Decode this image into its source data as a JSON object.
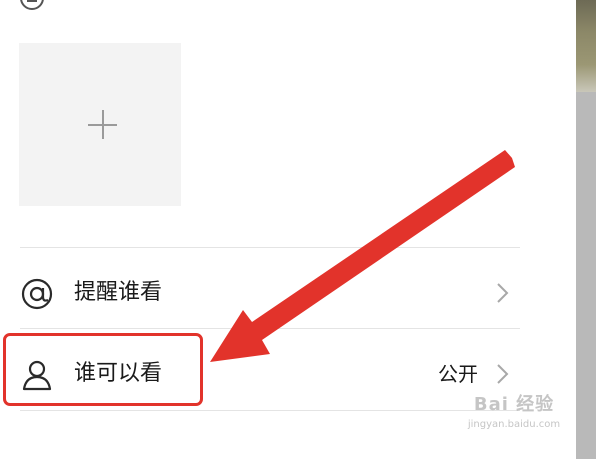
{
  "colors": {
    "accent_red": "#e2332b",
    "divider": "#e4e4e4",
    "add_tile": "#f3f3f3",
    "text": "#1a1a1a"
  },
  "add_photo": {
    "icon": "plus-icon"
  },
  "rows": [
    {
      "icon": "at-icon",
      "label": "提醒谁看",
      "value": "",
      "chevron": "chevron-right-icon"
    },
    {
      "icon": "person-icon",
      "label": "谁可以看",
      "value": "公开",
      "chevron": "chevron-right-icon"
    }
  ],
  "watermark": {
    "brand": "Bai 经验",
    "url": "jingyan.baidu.com"
  }
}
